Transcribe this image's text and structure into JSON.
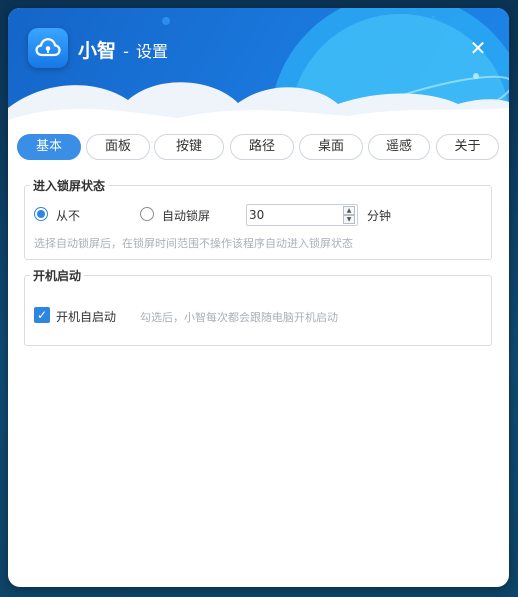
{
  "window": {
    "app_name": "小智",
    "separator": " - ",
    "title": "设置",
    "close_glyph": "✕"
  },
  "tabs": [
    {
      "label": "基本",
      "active": true
    },
    {
      "label": "面板",
      "active": false
    },
    {
      "label": "按键",
      "active": false
    },
    {
      "label": "路径",
      "active": false
    },
    {
      "label": "桌面",
      "active": false
    },
    {
      "label": "遥感",
      "active": false
    },
    {
      "label": "关于",
      "active": false
    }
  ],
  "lock_screen": {
    "title": "进入锁屏状态",
    "option_never": "从不",
    "option_auto": "自动锁屏",
    "selected": "never",
    "minutes_value": "30",
    "minutes_unit": "分钟",
    "hint": "选择自动锁屏后，在锁屏时间范围不操作该程序自动进入锁屏状态"
  },
  "startup": {
    "title": "开机启动",
    "checkbox_label": "开机自启动",
    "checked": true,
    "hint": "勾选后，小智每次都会跟随电脑开机启动"
  },
  "colors": {
    "accent": "#3a8ee6",
    "header": "#1a78dd",
    "background": "#0d3a5c"
  },
  "icons": {
    "logo": "cloud-lock-icon",
    "close": "close-icon",
    "check": "checkmark-icon"
  }
}
